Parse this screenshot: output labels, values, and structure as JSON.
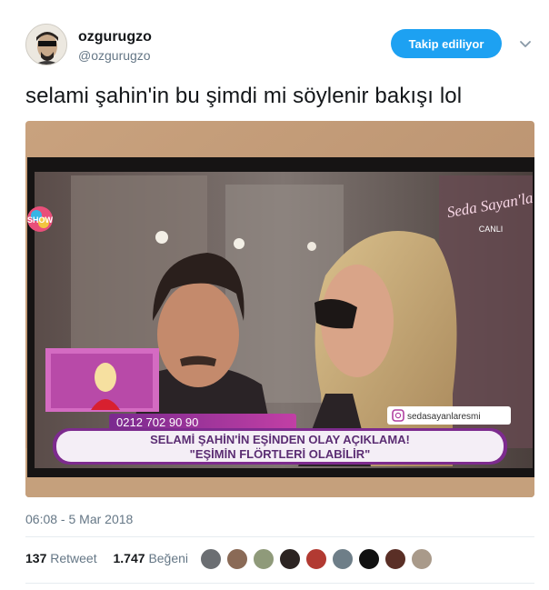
{
  "author": {
    "name": "ozgurugzo",
    "handle": "@ozgurugzo",
    "follow_label": "Takip ediliyor"
  },
  "tweet": {
    "text": "selami şahin'in bu şimdi mi söylenir bakışı lol",
    "timestamp": "06:08 - 5 Mar 2018"
  },
  "media": {
    "overlay_title": "Seda Sayan'la",
    "live_label": "CANLI",
    "channel_logo": "SHOW",
    "phone": "0212 702 90 90",
    "instagram_handle": "sedasayanlaresmi",
    "headline_line1": "SELAMİ ŞAHİN'İN EŞİNDEN OLAY AÇIKLAMA!",
    "headline_line2": "\"EŞİMİN FLÖRTLERİ OLABİLİR\""
  },
  "stats": {
    "retweet_count": "137",
    "retweet_label": "Retweet",
    "like_count": "1.747",
    "like_label": "Beğeni"
  },
  "likers": [
    "liker-avatar-1",
    "liker-avatar-2",
    "liker-avatar-3",
    "liker-avatar-4",
    "liker-avatar-5",
    "liker-avatar-6",
    "liker-avatar-7",
    "liker-avatar-8",
    "liker-avatar-9"
  ],
  "colors": {
    "accent": "#1da1f2",
    "text_primary": "#14171a",
    "text_secondary": "#657786"
  }
}
